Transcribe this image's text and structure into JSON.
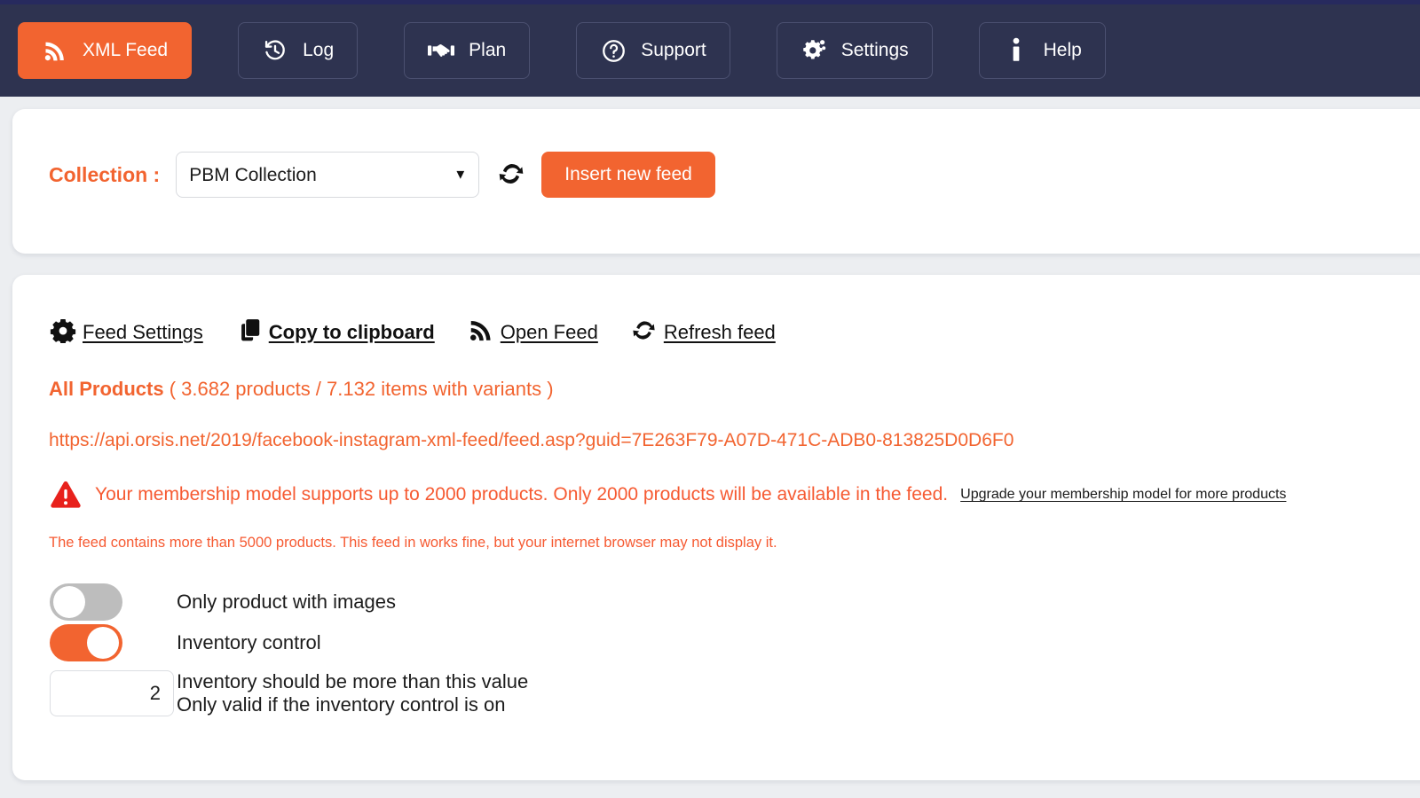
{
  "colors": {
    "accent": "#f26430",
    "navbar": "#2e3350",
    "top_strip": "#272a5e",
    "page_bg": "#eceef1",
    "warning": "#f65a32",
    "toggle_off": "#bdbdbd"
  },
  "navbar": {
    "items": [
      {
        "label": "XML Feed",
        "icon": "rss-icon",
        "active": true
      },
      {
        "label": "Log",
        "icon": "history-icon",
        "active": false
      },
      {
        "label": "Plan",
        "icon": "handshake-icon",
        "active": false
      },
      {
        "label": "Support",
        "icon": "question-circle-icon",
        "active": false
      },
      {
        "label": "Settings",
        "icon": "gears-icon",
        "active": false
      },
      {
        "label": "Help",
        "icon": "info-icon",
        "active": false
      }
    ]
  },
  "collection_card": {
    "label": "Collection :",
    "select_value": "PBM Collection",
    "select_options": [
      "PBM Collection"
    ],
    "refresh_icon": "refresh-icon",
    "insert_button": "Insert new feed"
  },
  "feed_card": {
    "actions": [
      {
        "label": "Feed Settings",
        "icon": "gear-icon",
        "bold": false
      },
      {
        "label": "Copy to clipboard",
        "icon": "clipboard-icon",
        "bold": true
      },
      {
        "label": "Open Feed",
        "icon": "rss-icon",
        "bold": false
      },
      {
        "label": "Refresh feed",
        "icon": "refresh-icon",
        "bold": false
      }
    ],
    "products_title": "All Products",
    "products_counts": "( 3.682 products / 7.132 items with variants )",
    "feed_url": "https://api.orsis.net/2019/facebook-instagram-xml-feed/feed.asp?guid=7E263F79-A07D-471C-ADB0-813825D0D6F0",
    "warning_icon": "warning-triangle-icon",
    "warning_text": "Your membership model supports up to 2000 products. Only 2000 products will be available in the feed.",
    "warning_link": "Upgrade your membership model for more products",
    "note_text": "The feed contains more than 5000 products. This feed in works fine, but your internet browser may not display it.",
    "toggles": [
      {
        "label": "Only product with images",
        "state": "off"
      },
      {
        "label": "Inventory control",
        "state": "on"
      }
    ],
    "inventory_value": "2",
    "inventory_desc_line1": "Inventory should be more than this value",
    "inventory_desc_line2": "Only valid if the inventory control is on"
  }
}
